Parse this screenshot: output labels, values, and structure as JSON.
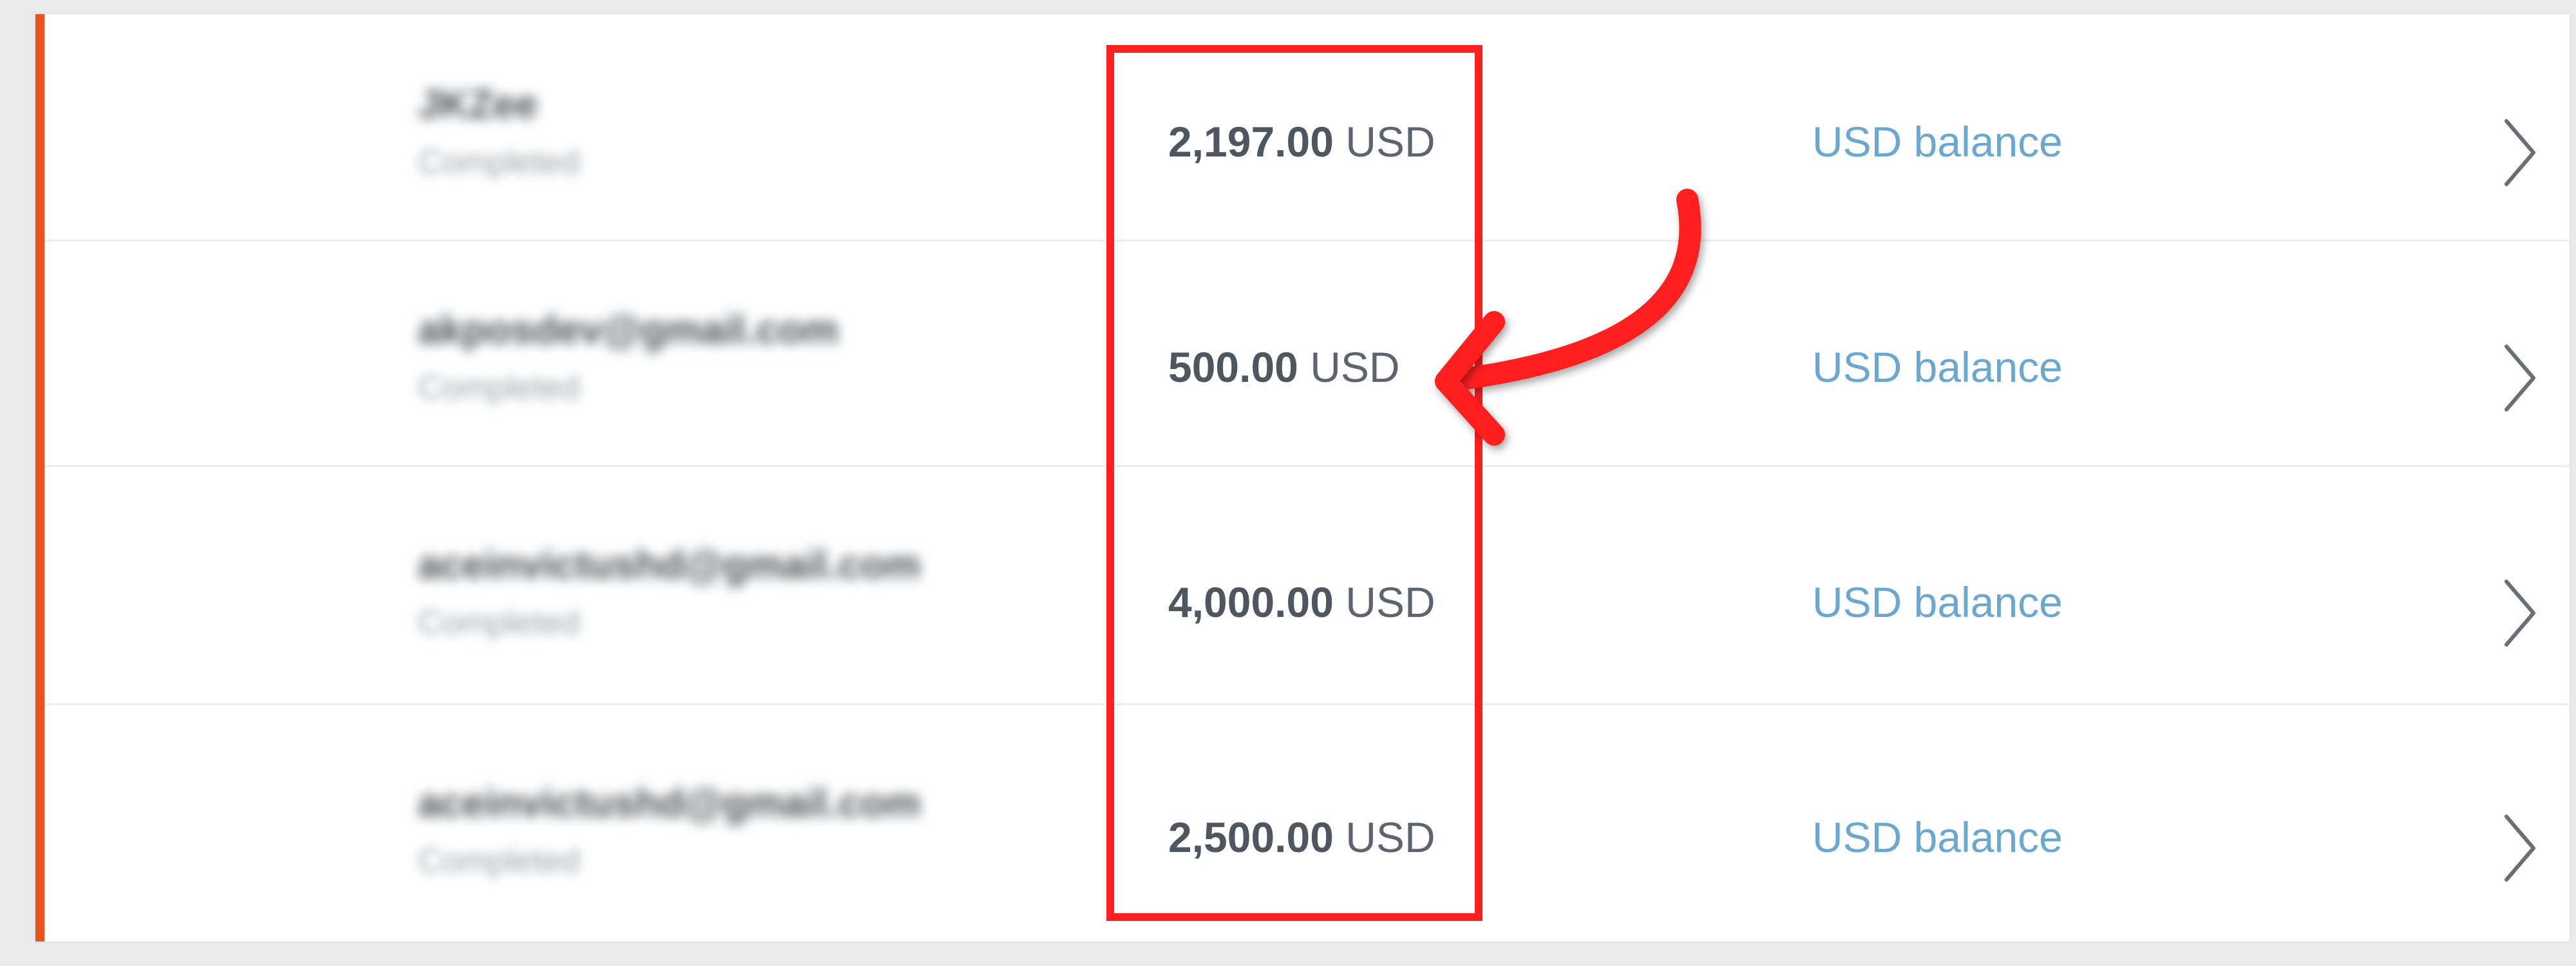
{
  "colors": {
    "accent_bar": "#e8531f",
    "highlight": "#ff1f1f",
    "link": "#6aa8d2",
    "chevron": "#6b6f75"
  },
  "transactions": [
    {
      "name": "JKZee",
      "status": "Completed",
      "amount": "2,197.00",
      "currency": "USD",
      "funding": "USD balance"
    },
    {
      "name": "akposdev@gmail.com",
      "status": "Completed",
      "amount": "500.00",
      "currency": "USD",
      "funding": "USD balance"
    },
    {
      "name": "aceinvictushd@gmail.com",
      "status": "Completed",
      "amount": "4,000.00",
      "currency": "USD",
      "funding": "USD balance"
    },
    {
      "name": "aceinvictushd@gmail.com",
      "status": "Completed",
      "amount": "2,500.00",
      "currency": "USD",
      "funding": "USD balance"
    }
  ],
  "icons": {
    "row_action": "chevron-right-icon",
    "annotation": "curved-arrow-icon"
  }
}
